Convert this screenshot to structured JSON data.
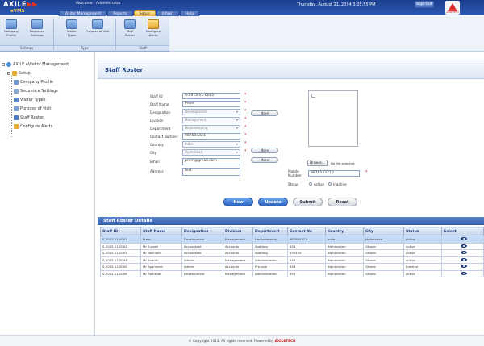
{
  "header": {
    "logo_top": "AXILE",
    "logo_bottom": "eVMS",
    "welcome": "Welcome : Administrator",
    "datetime": "Thursday, August 21, 2014  3:05:55 PM",
    "signout": "Sign Out",
    "brand_text": "AXILE TECH"
  },
  "tabs": [
    {
      "label": "Visitor Management",
      "active": false
    },
    {
      "label": "Reports",
      "active": false
    },
    {
      "label": "Setup",
      "active": true
    },
    {
      "label": "Admin",
      "active": false
    },
    {
      "label": "Help",
      "active": false
    }
  ],
  "ribbon": {
    "buttons": [
      "Company Profile",
      "Sequence Settings",
      "Visitor Types",
      "Purpose of Visit",
      "Staff Roster",
      "Configure Alerts"
    ],
    "groups": [
      "Settings",
      "Type",
      "Staff"
    ]
  },
  "tree": {
    "root": "AXILE eVisitor Management",
    "setup": "Setup",
    "items": [
      "Company Profile",
      "Sequence Settings",
      "Visitor Types",
      "Purpose of visit",
      "Staff Roster",
      "Configure Alerts"
    ]
  },
  "page": {
    "title": "Staff Roster"
  },
  "form": {
    "labels": {
      "staff_id": "Staff ID",
      "staff_name": "Staff Name",
      "designation": "Designation",
      "division": "Division",
      "department": "Department",
      "contact": "Contact Number",
      "country": "Country",
      "city": "City",
      "email": "Email",
      "address": "Address",
      "mobile": "Mobile Number",
      "status": "Status"
    },
    "values": {
      "staff_id": "S-2013-11-0001",
      "staff_name": "Prem",
      "designation": "Development",
      "division": "Management",
      "department": "Housekeeping",
      "contact": "987654321",
      "country": "India",
      "city": "Hyderabad",
      "email": "prem@gmail.com",
      "address": "test",
      "mobile": "9876543210"
    },
    "more_label": "More",
    "browse": "Browse...",
    "no_file": "No file selected.",
    "status_active": "Active",
    "status_inactive": "Inactive",
    "status_selected": "Active"
  },
  "actions": {
    "new": "New",
    "update": "Update",
    "submit": "Submit",
    "reset": "Reset"
  },
  "details": {
    "title": "Staff Roster Details",
    "columns": [
      "Staff ID",
      "Staff Name",
      "Designation",
      "Division",
      "Department",
      "Contact No",
      "Country",
      "City",
      "Status",
      "Select"
    ],
    "rows": [
      [
        "S-2013-11-0001",
        "Prem",
        "Development",
        "Management",
        "Housekeeping",
        "987654321",
        "India",
        "Hyderabad",
        "Active"
      ],
      [
        "S-2013-11-0002",
        "Mr Suresh",
        "Accountant",
        "Accounts",
        "Auditing",
        "456",
        "Afghanistan",
        "Ghazni",
        "Active"
      ],
      [
        "S-2013-11-0003",
        "Mr Nachiath",
        "Accountant",
        "Accounts",
        "Auditing",
        "435435",
        "Afghanistan",
        "Ghazni",
        "Active"
      ],
      [
        "S-2013-11-0004",
        "Mr Ananth",
        "Admin",
        "Management",
        "Administration",
        "543",
        "Afghanistan",
        "Ghazni",
        "Active"
      ],
      [
        "S-2013-11-0005",
        "Mr Aparvlesh",
        "Admin",
        "Accounts",
        "Pre-sale",
        "456",
        "Afghanistan",
        "Ghazni",
        "Inactive"
      ],
      [
        "S-2013-11-0006",
        "Mr Ramesar",
        "Development",
        "Management",
        "Administration",
        "455",
        "Afghanistan",
        "Ghazni",
        "Active"
      ]
    ],
    "selected_row": 0
  },
  "footer": {
    "text": "© Copyright 2013. All rights reserved. Powered by",
    "brand": "AXILETECH"
  },
  "colors": {
    "header": "#2a56b0",
    "active_tab": "#f4b43c",
    "accent": "#2f5eb0",
    "required": "#d02020"
  }
}
